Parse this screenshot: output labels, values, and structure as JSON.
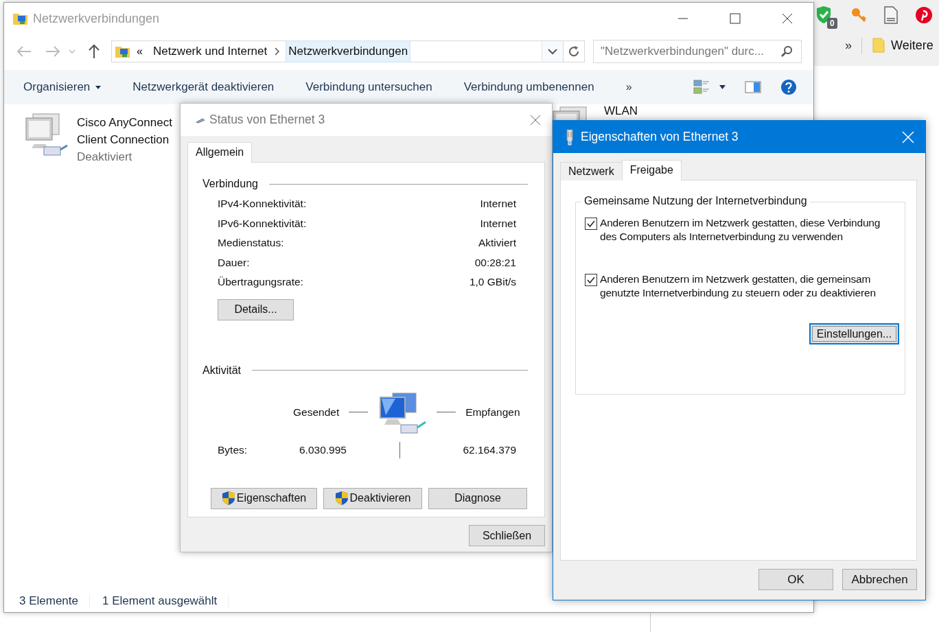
{
  "browser": {
    "extension_badge": "0",
    "overflow": "»",
    "bookmark": "Weitere"
  },
  "explorer": {
    "title": "Netzwerkverbindungen",
    "address": {
      "overflow": "«",
      "crumbs": [
        {
          "label": "Netzwerk und Internet",
          "selected": false
        },
        {
          "label": "Netzwerkverbindungen",
          "selected": true
        }
      ]
    },
    "search": {
      "placeholder": "\"Netzwerkverbindungen\" durc..."
    },
    "toolbar": [
      {
        "label": "Organisieren",
        "has_menu": true
      },
      {
        "label": "Netzwerkgerät deaktivieren",
        "has_menu": false
      },
      {
        "label": "Verbindung untersuchen",
        "has_menu": false
      },
      {
        "label": "Verbindung umbenennen",
        "has_menu": false
      }
    ],
    "toolbar_more": "»",
    "items": [
      {
        "lines": [
          "Cisco AnyConnect",
          "Client Connection"
        ],
        "status": "Deaktiviert"
      },
      {
        "lines": [
          "WLAN"
        ]
      }
    ],
    "status_bar": [
      "3 Elemente",
      "1 Element ausgewählt"
    ]
  },
  "status_dialog": {
    "title": "Status von Ethernet 3",
    "tabs": [
      {
        "label": "Allgemein",
        "selected": true
      }
    ],
    "connection": {
      "heading": "Verbindung",
      "rows": [
        {
          "label": "IPv4-Konnektivität:",
          "value": "Internet"
        },
        {
          "label": "IPv6-Konnektivität:",
          "value": "Internet"
        },
        {
          "label": "Medienstatus:",
          "value": "Aktiviert"
        },
        {
          "label": "Dauer:",
          "value": "00:28:21"
        },
        {
          "label": "Übertragungsrate:",
          "value": "1,0 GBit/s"
        }
      ]
    },
    "details_button": "Details...",
    "activity": {
      "heading": "Aktivität",
      "sent_label": "Gesendet",
      "received_label": "Empfangen",
      "bytes_label": "Bytes:",
      "sent": "6.030.995",
      "received": "62.164.379"
    },
    "buttons": [
      {
        "label": "Eigenschaften",
        "shield": true
      },
      {
        "label": "Deaktivieren",
        "shield": true
      },
      {
        "label": "Diagnose",
        "shield": false
      }
    ],
    "close_button": "Schließen"
  },
  "properties_dialog": {
    "title": "Eigenschaften von Ethernet 3",
    "active": true,
    "tabs": [
      {
        "label": "Netzwerk",
        "selected": false
      },
      {
        "label": "Freigabe",
        "selected": true
      }
    ],
    "group_title": "Gemeinsame Nutzung der Internetverbindung",
    "options": [
      {
        "label": "Anderen Benutzern im Netzwerk gestatten, diese Verbindung des Computers als Internetverbindung zu verwenden",
        "checked": true
      },
      {
        "label": "Anderen Benutzern im Netzwerk gestatten, die gemeinsam genutzte Internetverbindung zu steuern oder zu deaktivieren",
        "checked": true
      }
    ],
    "settings_button": {
      "label": "Einstellungen...",
      "focused": true
    },
    "buttons": [
      "OK",
      "Abbrechen"
    ]
  }
}
